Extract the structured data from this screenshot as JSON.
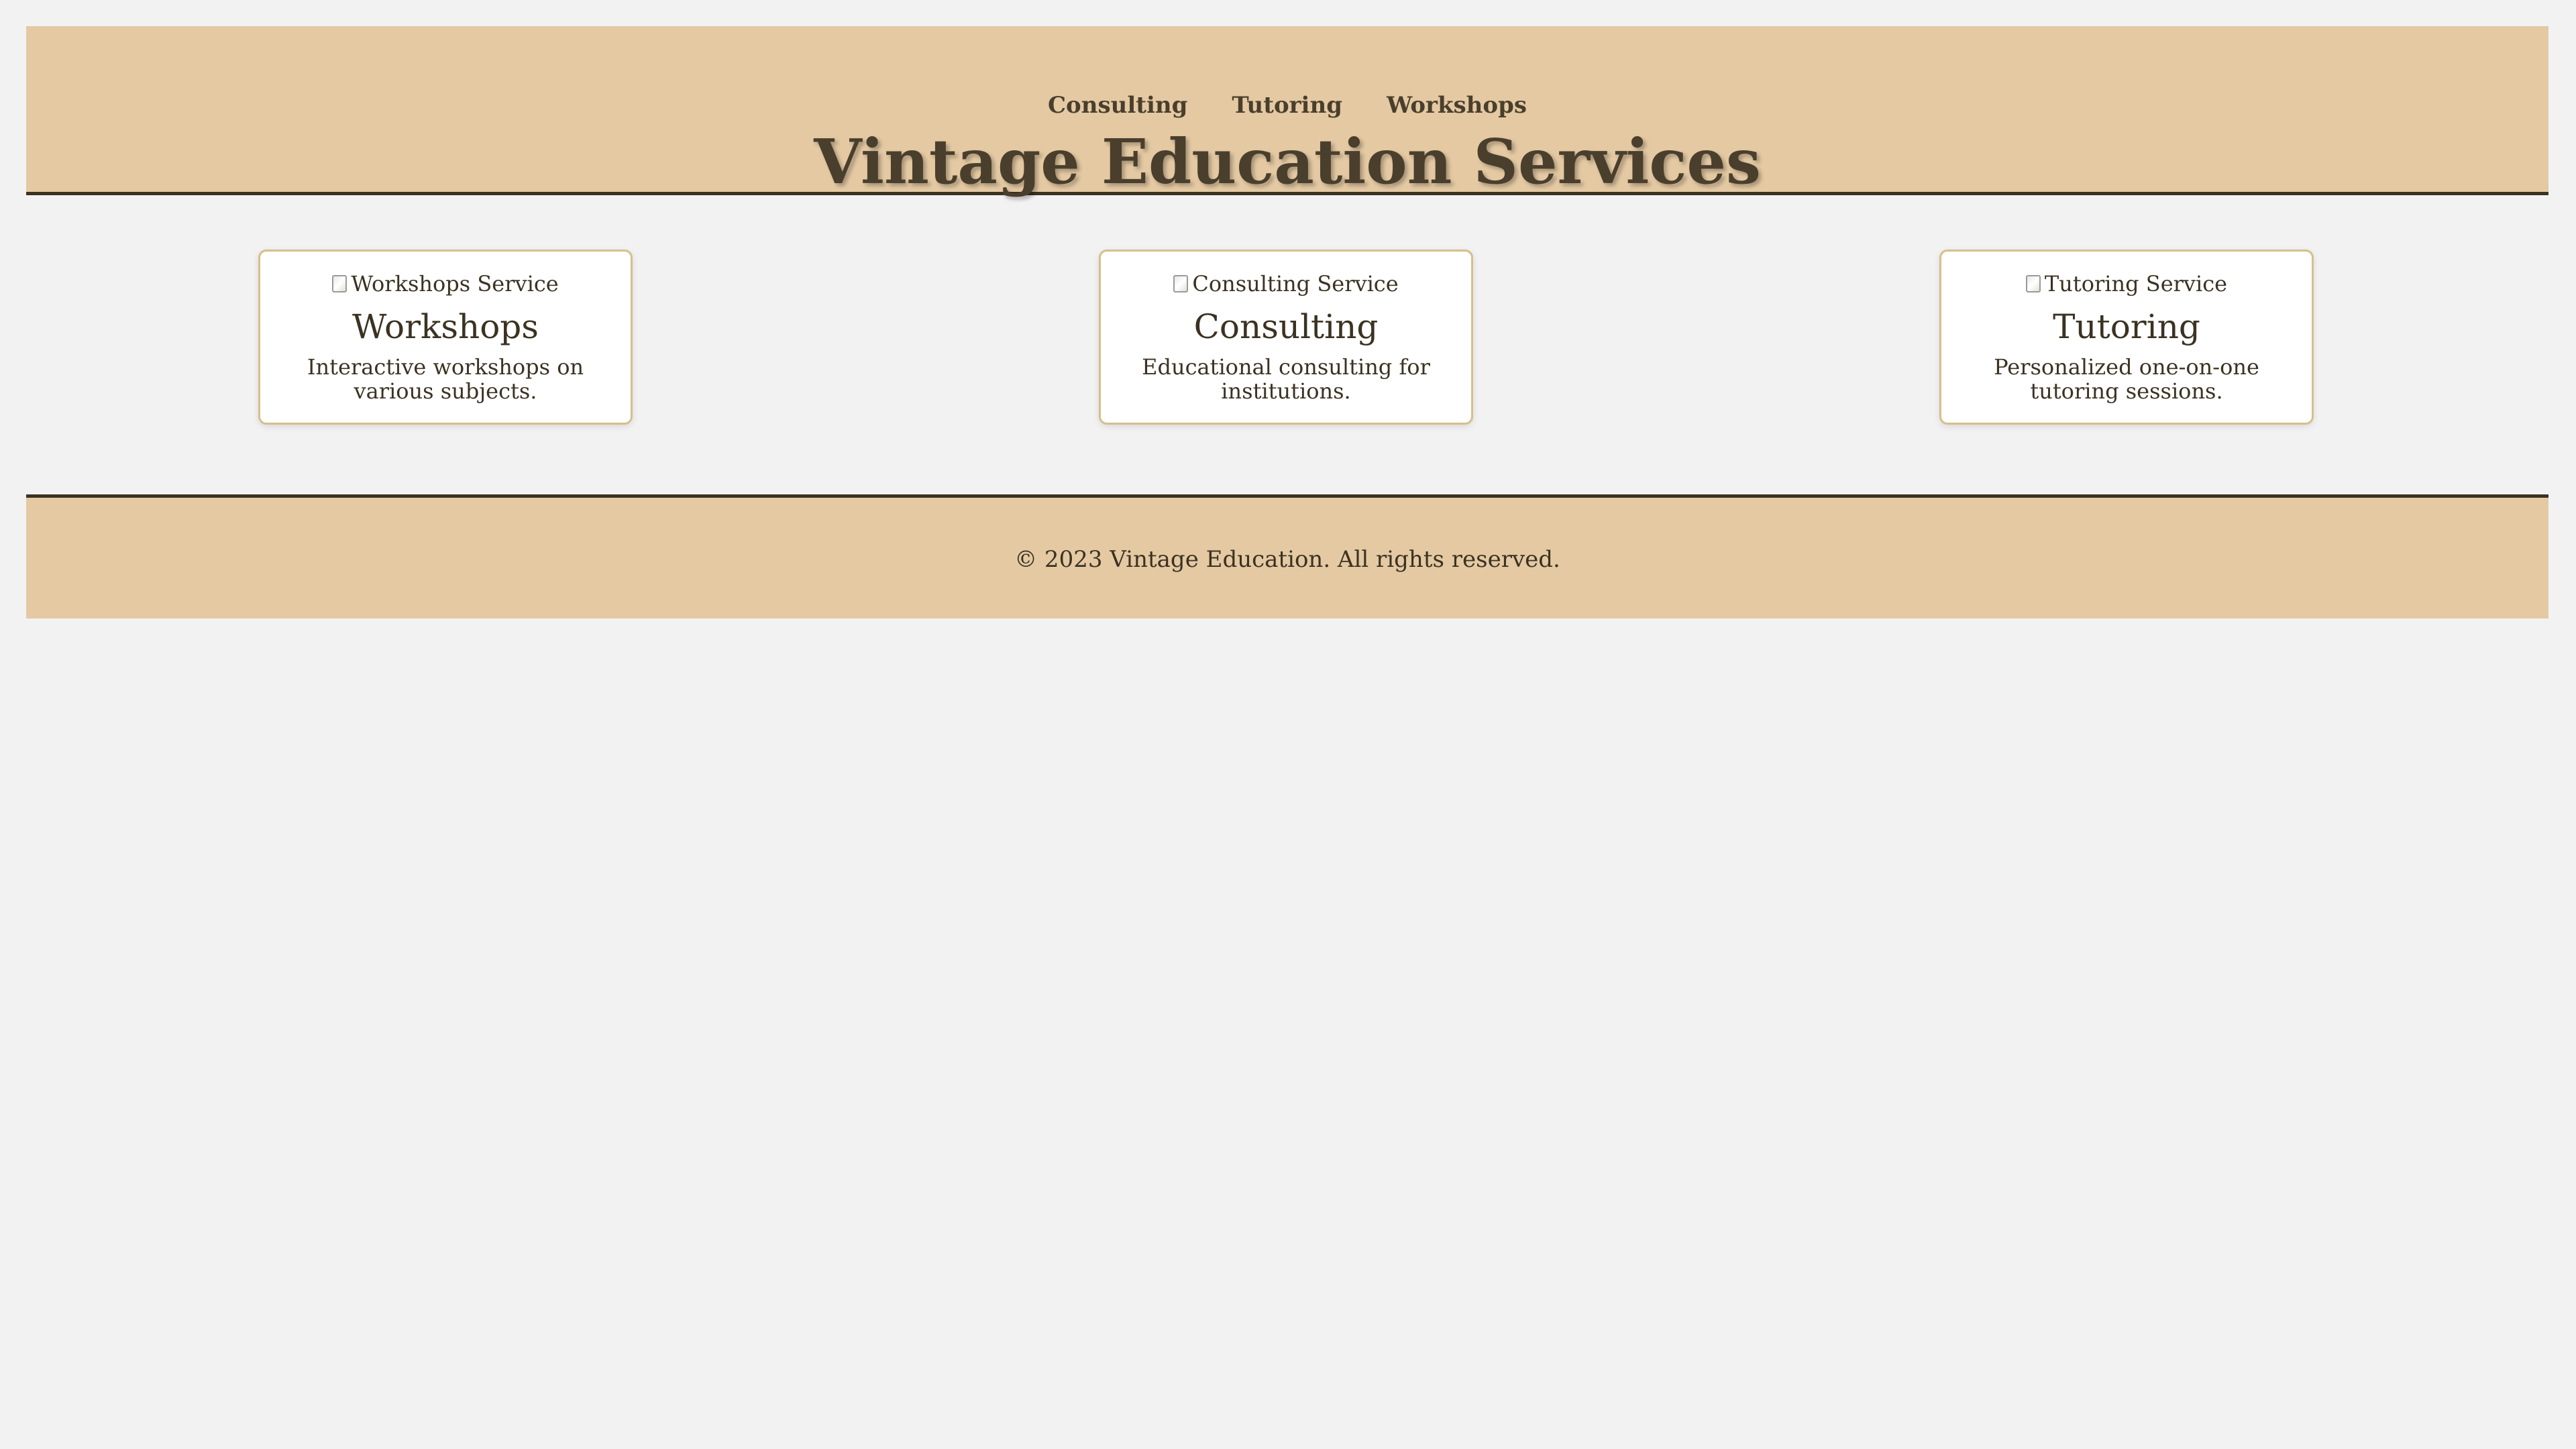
{
  "header": {
    "nav": [
      "Consulting",
      "Tutoring",
      "Workshops"
    ],
    "title": "Vintage Education Services"
  },
  "services": [
    {
      "image_alt": "Workshops Service",
      "title": "Workshops",
      "description": "Interactive workshops on various subjects."
    },
    {
      "image_alt": "Consulting Service",
      "title": "Consulting",
      "description": "Educational consulting for institutions."
    },
    {
      "image_alt": "Tutoring Service",
      "title": "Tutoring",
      "description": "Personalized one-on-one tutoring sessions."
    }
  ],
  "footer": {
    "text": "© 2023 Vintage Education. All rights reserved."
  },
  "colors": {
    "header_bg": "#e4c9a3",
    "page_bg": "#f2f2f2",
    "text": "#3b3222",
    "card_border": "#d6bf8a"
  }
}
